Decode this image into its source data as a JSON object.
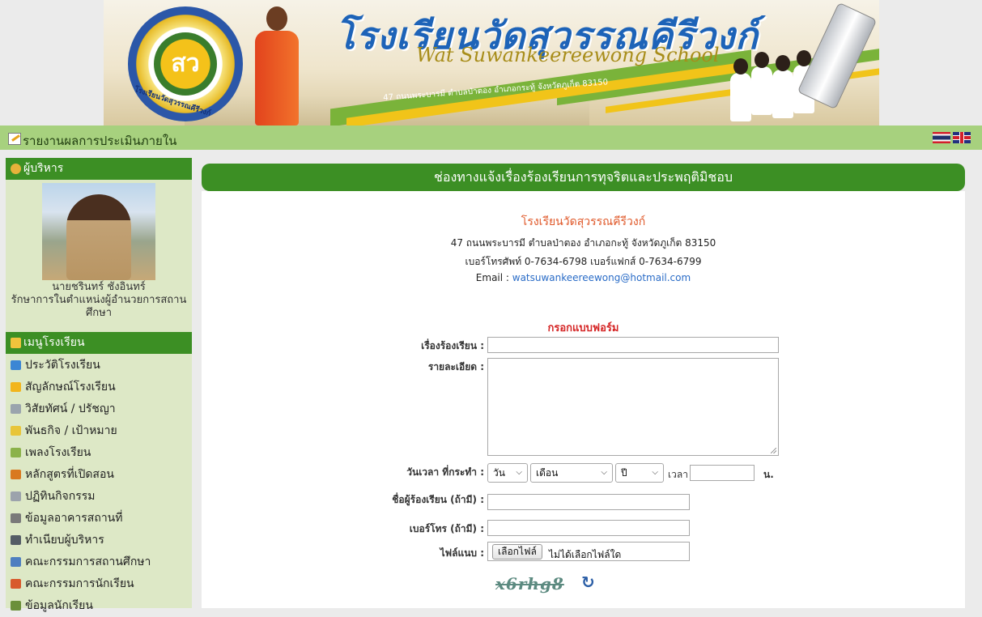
{
  "banner": {
    "logo_text": "สว",
    "logo_name": "โรงเรียนวัดสุวรรณคีรีวงก์",
    "title_th": "โรงเรียนวัดสุวรรณคีรีวงก์",
    "title_en": "Wat Suwankeereewong School",
    "address": "47 ถนนพระบารมี ตำบลป่าตอง อำเภอกระทู้ จังหวัดภูเก็ต 83150"
  },
  "topbar": {
    "label": "รายงานผลการประเมินภายใน",
    "flags": [
      "thai-flag",
      "uk-flag"
    ]
  },
  "sidebar": {
    "admin_header": "ผู้บริหาร",
    "admin_name": "นายชรินทร์ ชังอินทร์",
    "admin_position": "รักษาการในตำแหน่งผู้อำนวยการสถานศึกษา",
    "menu_header": "เมนูโรงเรียน",
    "menu": [
      {
        "label": "ประวัติโรงเรียน",
        "icon": "monitor-icon",
        "color": "#3b86d4"
      },
      {
        "label": "สัญลักษณ์โรงเรียน",
        "icon": "star-icon",
        "color": "#f2b51d"
      },
      {
        "label": "วิสัยทัศน์ / ปรัชญา",
        "icon": "gear-icon",
        "color": "#9aa4ad"
      },
      {
        "label": "พันธกิจ / เป้าหมาย",
        "icon": "flag-icon",
        "color": "#e8c53a"
      },
      {
        "label": "เพลงโรงเรียน",
        "icon": "image-icon",
        "color": "#8bb24a"
      },
      {
        "label": "หลักสูตรที่เปิดสอน",
        "icon": "edit-icon",
        "color": "#d9791f"
      },
      {
        "label": "ปฏิทินกิจกรรม",
        "icon": "calendar-icon",
        "color": "#9ca3ac"
      },
      {
        "label": "ข้อมูลอาคารสถานที่",
        "icon": "home-icon",
        "color": "#7a7a7a"
      },
      {
        "label": "ทำเนียบผู้บริหาร",
        "icon": "user-icon",
        "color": "#555d66"
      },
      {
        "label": "คณะกรรมการสถานศึกษา",
        "icon": "group-icon",
        "color": "#4f7fc0"
      },
      {
        "label": "คณะกรรมการนักเรียน",
        "icon": "group-icon",
        "color": "#d85a2c"
      },
      {
        "label": "ข้อมูลนักเรียน",
        "icon": "graduate-icon",
        "color": "#6b8f3a"
      }
    ]
  },
  "main": {
    "title": "ช่องทางแจ้งเรื่องร้องเรียนการทุจริตและประพฤติมิชอบ",
    "school_name": "โรงเรียนวัดสุวรรณคีรีวงก์",
    "address": "47 ถนนพระบารมี ตำบลป่าตอง อำเภอกะทู้ จังหวัดภูเก็ต 83150",
    "phone": "เบอร์โทรศัพท์ 0-7634-6798 เบอร์แฟกส์ 0-7634-6799",
    "email_label": "Email : ",
    "email": "watsuwankeereewong@hotmail.com",
    "form_title": "กรอกแบบฟอร์ม",
    "form": {
      "subject_label": "เรื่องร้องเรียน :",
      "subject_value": "",
      "detail_label": "รายละเอียด :",
      "detail_value": "",
      "datetime_label": "วันเวลา ที่กระทำ :",
      "day_selected": "วัน",
      "month_selected": "เดือน",
      "year_selected": "ปี",
      "time_label": "เวลา",
      "time_value": "",
      "time_unit": "น.",
      "name_label": "ชื่อผู้ร้องเรียน (ถ้ามี) :",
      "name_value": "",
      "phone_label": "เบอร์โทร (ถ้ามี) :",
      "phone_value": "",
      "file_label": "ไฟล์แนบ :",
      "file_button": "เลือกไฟล์",
      "file_status": "ไม่ได้เลือกไฟล์ใด",
      "captcha_text": "x6rhg8",
      "refresh_icon": "refresh-icon"
    }
  }
}
